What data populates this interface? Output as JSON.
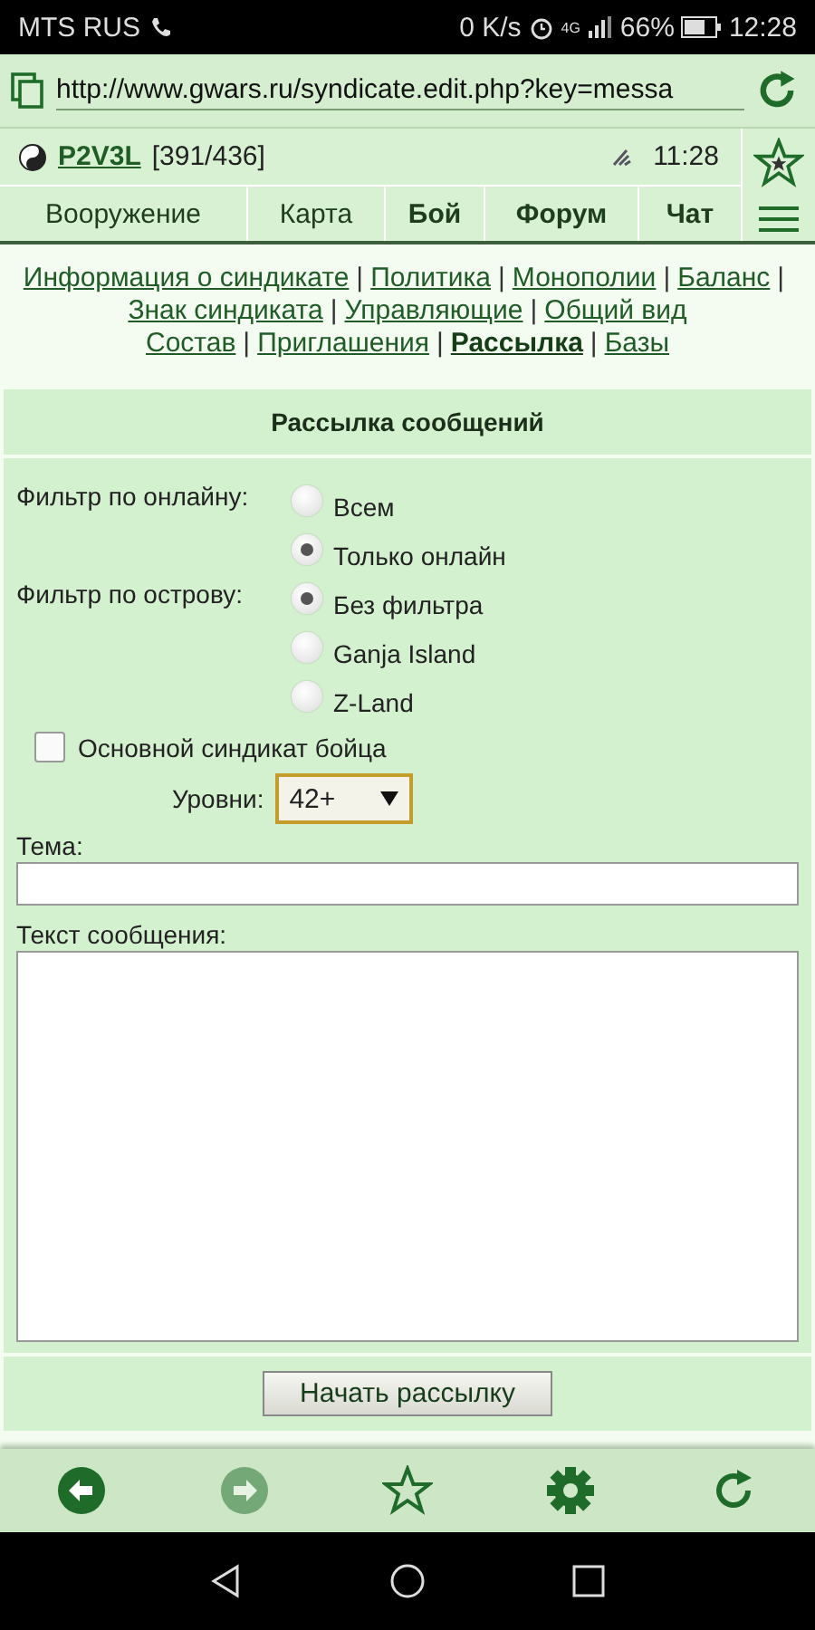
{
  "status_bar": {
    "carrier": "MTS RUS",
    "speed": "0 K/s",
    "network": "4G",
    "battery": "66%",
    "time": "12:28"
  },
  "address_bar": {
    "url": "http://www.gwars.ru/syndicate.edit.php?key=messa"
  },
  "header": {
    "player": "P2V3L",
    "stats": "[391/436]",
    "time": "11:28"
  },
  "nav_tabs": [
    {
      "label": "Вооружение",
      "emphasized": false
    },
    {
      "label": "Карта",
      "emphasized": false
    },
    {
      "label": "Бой",
      "emphasized": true
    },
    {
      "label": "Форум",
      "emphasized": true
    },
    {
      "label": "Чат",
      "emphasized": true
    }
  ],
  "section_links": {
    "separator": "|",
    "lines": [
      {
        "trailing": "|",
        "items": [
          {
            "label": "Информация о синдикате",
            "selected": false
          },
          {
            "label": "Политика",
            "selected": false
          },
          {
            "label": "Монополии",
            "selected": false
          },
          {
            "label": "Баланс",
            "selected": false
          }
        ]
      },
      {
        "items": [
          {
            "label": "Знак синдиката",
            "selected": false
          },
          {
            "label": "Управляющие",
            "selected": false
          },
          {
            "label": "Общий вид",
            "selected": false
          }
        ]
      },
      {
        "items": [
          {
            "label": "Состав",
            "selected": false
          },
          {
            "label": "Приглашения",
            "selected": false
          },
          {
            "label": "Рассылка",
            "selected": true
          },
          {
            "label": "Базы",
            "selected": false
          }
        ]
      }
    ]
  },
  "form": {
    "title": "Рассылка сообщений",
    "filters": [
      {
        "label": "Фильтр по онлайну:",
        "options": [
          {
            "label": "Всем",
            "selected": false
          },
          {
            "label": "Только онлайн",
            "selected": true
          }
        ]
      },
      {
        "label": "Фильтр по острову:",
        "options": [
          {
            "label": "Без фильтра",
            "selected": true
          },
          {
            "label": "Ganja Island",
            "selected": false
          },
          {
            "label": "Z-Land",
            "selected": false
          }
        ]
      }
    ],
    "main_syndicate": {
      "label": "Основной синдикат бойца",
      "checked": false
    },
    "levels": {
      "label": "Уровни:",
      "value": "42+"
    },
    "subject": {
      "label": "Тема:"
    },
    "message": {
      "label": "Текст сообщения:"
    },
    "submit": "Начать рассылку"
  },
  "toolbar": [
    {
      "kind": "back",
      "disabled": false
    },
    {
      "kind": "forward",
      "disabled": true
    },
    {
      "kind": "star",
      "disabled": false
    },
    {
      "kind": "settings",
      "disabled": false
    },
    {
      "kind": "refresh",
      "disabled": false
    }
  ]
}
